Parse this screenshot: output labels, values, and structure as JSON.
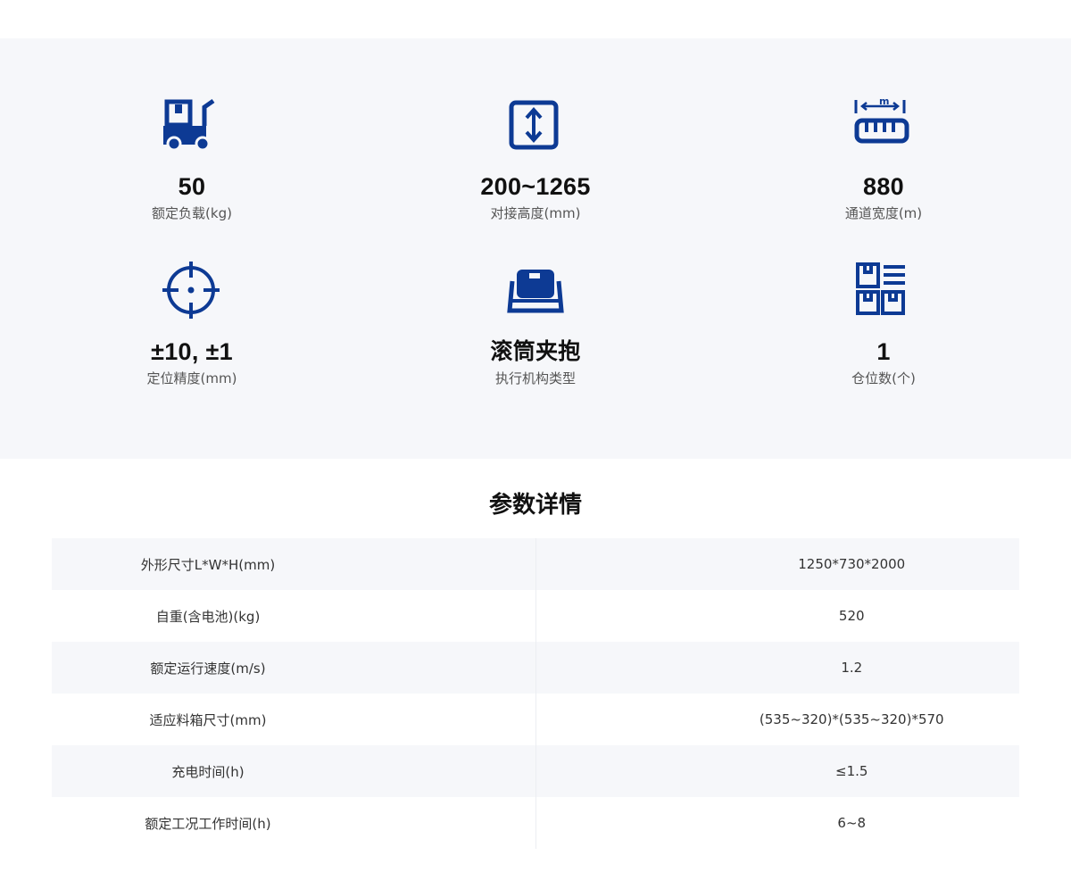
{
  "colors": {
    "accent": "#0d3a94",
    "panel_bg": "#f6f7fa"
  },
  "specs": [
    {
      "icon": "forklift-cart-icon",
      "value": "50",
      "label": "额定负载(kg)"
    },
    {
      "icon": "height-arrows-icon",
      "value": "200~1265",
      "label": "对接高度(mm)"
    },
    {
      "icon": "ruler-width-icon",
      "value": "880",
      "label": "通道宽度(m)",
      "icon_text": "m"
    },
    {
      "icon": "crosshair-target-icon",
      "value": "±10, ±1",
      "label": "定位精度(mm)"
    },
    {
      "icon": "roller-clamp-box-icon",
      "value": "滚筒夹抱",
      "label": "执行机构类型"
    },
    {
      "icon": "storage-slots-icon",
      "value": "1",
      "label": "仓位数(个)"
    }
  ],
  "section_title": "参数详情",
  "params": [
    {
      "name": "外形尺寸L*W*H(mm)",
      "value": "1250*730*2000"
    },
    {
      "name": "自重(含电池)(kg)",
      "value": "520"
    },
    {
      "name": "额定运行速度(m/s)",
      "value": "1.2"
    },
    {
      "name": "适应料箱尺寸(mm)",
      "value": "(535~320)*(535~320)*570"
    },
    {
      "name": "充电时间(h)",
      "value": "≤1.5"
    },
    {
      "name": "额定工况工作时间(h)",
      "value": "6~8"
    }
  ]
}
